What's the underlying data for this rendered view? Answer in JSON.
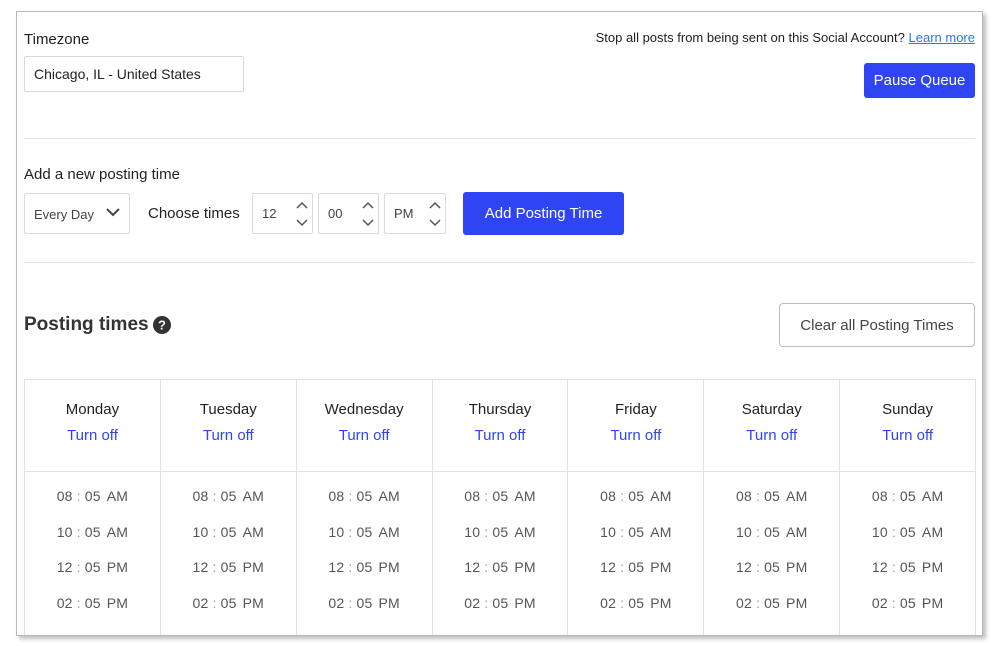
{
  "timezone": {
    "label": "Timezone",
    "value": "Chicago, IL - United States"
  },
  "queue": {
    "stop_text": "Stop all posts from being sent on this Social Account?",
    "learn_more": "Learn more",
    "pause_label": "Pause Queue"
  },
  "add_time": {
    "label": "Add a new posting time",
    "day_select": "Every Day",
    "choose_label": "Choose times",
    "hour": "12",
    "minute": "00",
    "ampm": "PM",
    "button_label": "Add Posting Time"
  },
  "posting_times": {
    "title": "Posting times",
    "clear_label": "Clear all Posting Times",
    "turn_off_label": "Turn off",
    "days": [
      {
        "name": "Monday",
        "times": [
          [
            "08",
            "05",
            "AM"
          ],
          [
            "10",
            "05",
            "AM"
          ],
          [
            "12",
            "05",
            "PM"
          ],
          [
            "02",
            "05",
            "PM"
          ]
        ]
      },
      {
        "name": "Tuesday",
        "times": [
          [
            "08",
            "05",
            "AM"
          ],
          [
            "10",
            "05",
            "AM"
          ],
          [
            "12",
            "05",
            "PM"
          ],
          [
            "02",
            "05",
            "PM"
          ]
        ]
      },
      {
        "name": "Wednesday",
        "times": [
          [
            "08",
            "05",
            "AM"
          ],
          [
            "10",
            "05",
            "AM"
          ],
          [
            "12",
            "05",
            "PM"
          ],
          [
            "02",
            "05",
            "PM"
          ]
        ]
      },
      {
        "name": "Thursday",
        "times": [
          [
            "08",
            "05",
            "AM"
          ],
          [
            "10",
            "05",
            "AM"
          ],
          [
            "12",
            "05",
            "PM"
          ],
          [
            "02",
            "05",
            "PM"
          ]
        ]
      },
      {
        "name": "Friday",
        "times": [
          [
            "08",
            "05",
            "AM"
          ],
          [
            "10",
            "05",
            "AM"
          ],
          [
            "12",
            "05",
            "PM"
          ],
          [
            "02",
            "05",
            "PM"
          ]
        ]
      },
      {
        "name": "Saturday",
        "times": [
          [
            "08",
            "05",
            "AM"
          ],
          [
            "10",
            "05",
            "AM"
          ],
          [
            "12",
            "05",
            "PM"
          ],
          [
            "02",
            "05",
            "PM"
          ]
        ]
      },
      {
        "name": "Sunday",
        "times": [
          [
            "08",
            "05",
            "AM"
          ],
          [
            "10",
            "05",
            "AM"
          ],
          [
            "12",
            "05",
            "PM"
          ],
          [
            "02",
            "05",
            "PM"
          ]
        ]
      }
    ]
  },
  "colors": {
    "primary": "#2f45f3",
    "link": "#2a7ae2"
  },
  "icons": {
    "select": "chevron-down-icon",
    "spin": "up-down-arrows-icon",
    "help": "question-circle-icon"
  }
}
